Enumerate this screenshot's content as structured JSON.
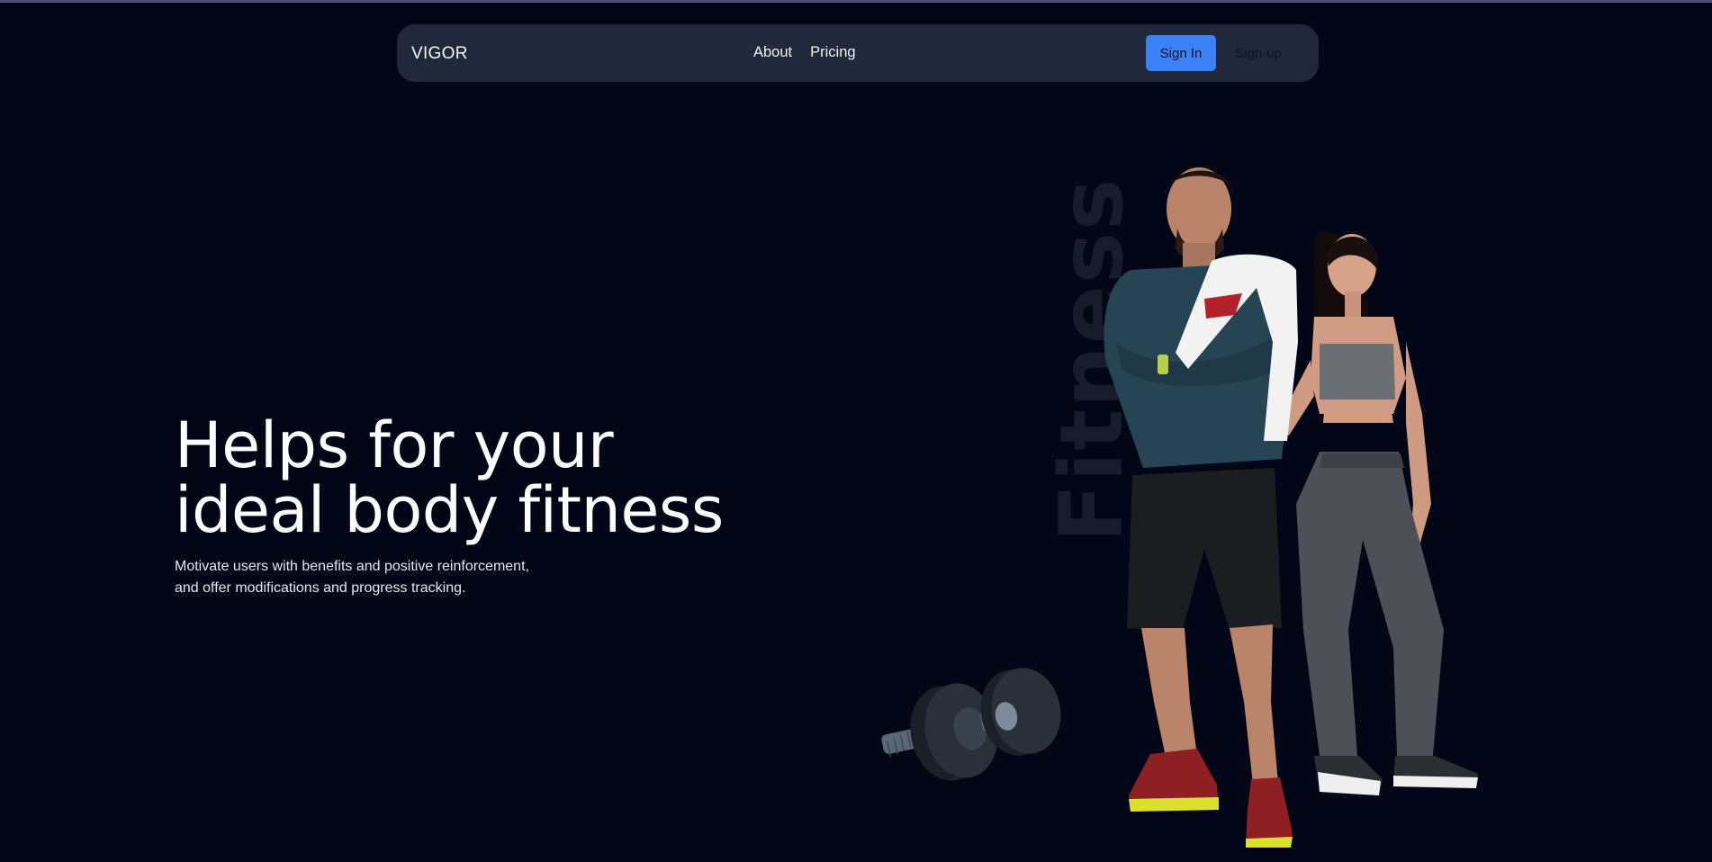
{
  "header": {
    "brand": "VIGOR",
    "nav": [
      "About",
      "Pricing"
    ],
    "sign_in_label": "Sign In",
    "sign_up_label": "Sign-up"
  },
  "hero": {
    "title_line_1": "Helps for your",
    "title_line_2": "ideal body fitness",
    "subtitle_line_1": "Motivate users with benefits and positive reinforcement,",
    "subtitle_line_2": "and offer modifications and progress tracking.",
    "background_word": "Fitness"
  },
  "colors": {
    "background": "#030617",
    "navbar": "#1f293b",
    "accent": "#3b82f6"
  }
}
